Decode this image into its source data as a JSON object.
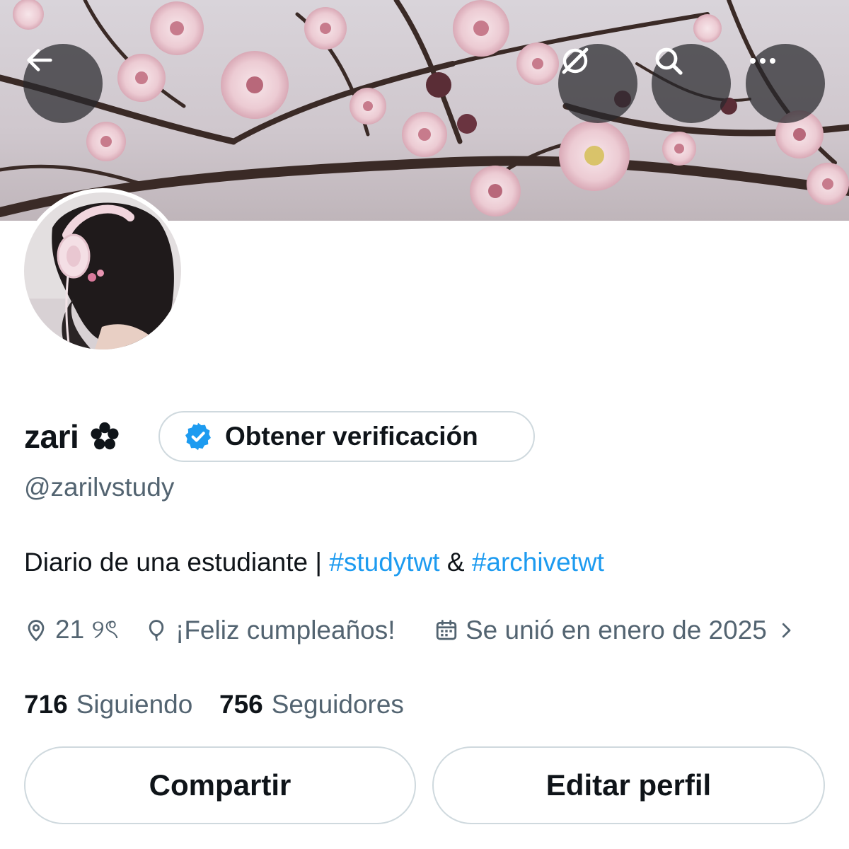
{
  "header": {
    "back_icon": "arrow-left-icon",
    "grok_icon": "grok-icon",
    "search_icon": "search-icon",
    "more_icon": "more-horizontal-icon"
  },
  "profile": {
    "display_name": "zari",
    "name_emoji": "flower-icon",
    "verify_button_label": "Obtener verificación",
    "handle": "@zarilvstudy",
    "bio": {
      "prefix": "Diario de una estudiante | ",
      "hashtag_1": "#studytwt",
      "middle": " & ",
      "hashtag_2": "#archivetwt"
    },
    "location": "21 ୨ৎ",
    "birthday": "¡Feliz cumpleaños!",
    "joined": "Se unió en enero de 2025",
    "following_count": "716",
    "following_label": "Siguiendo",
    "followers_count": "756",
    "followers_label": "Seguidores"
  },
  "actions": {
    "share_label": "Compartir",
    "edit_label": "Editar perfil"
  },
  "colors": {
    "accent": "#1d9bf0",
    "secondary_text": "#536471",
    "primary_text": "#0f1419",
    "border": "#cfd9de"
  }
}
